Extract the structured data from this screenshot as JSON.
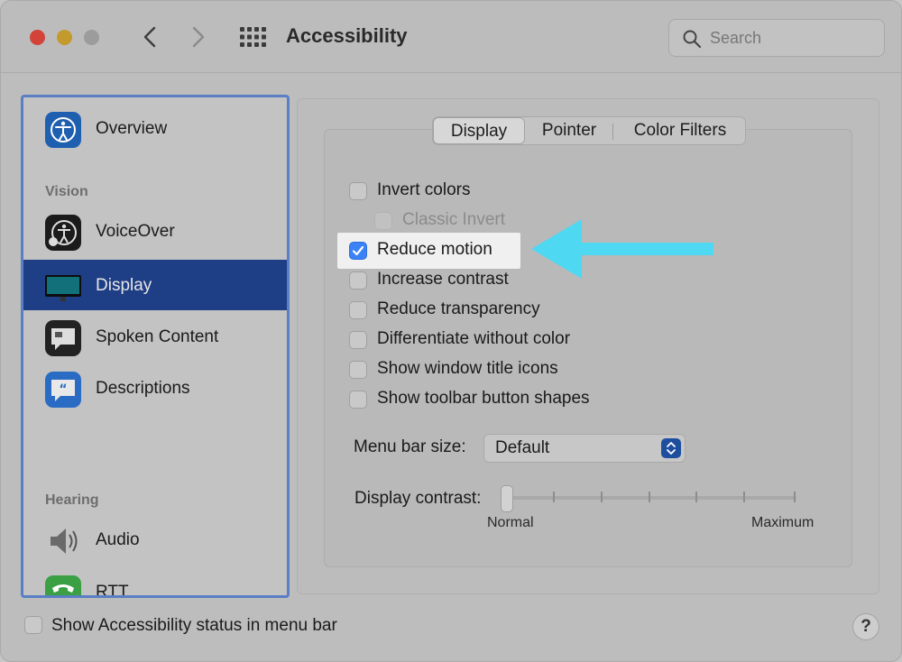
{
  "window": {
    "title": "Accessibility",
    "search_placeholder": "Search"
  },
  "sidebar": {
    "overview": "Overview",
    "section_vision": "Vision",
    "voiceover": "VoiceOver",
    "display": "Display",
    "spoken_content": "Spoken Content",
    "descriptions": "Descriptions",
    "section_hearing": "Hearing",
    "audio": "Audio",
    "rtt": "RTT"
  },
  "tabs": [
    "Display",
    "Pointer",
    "Color Filters"
  ],
  "options": [
    {
      "label": "Invert colors",
      "checked": false,
      "disabled": false
    },
    {
      "label": "Classic Invert",
      "checked": false,
      "disabled": true
    },
    {
      "label": "Reduce motion",
      "checked": true,
      "disabled": false
    },
    {
      "label": "Increase contrast",
      "checked": false,
      "disabled": false
    },
    {
      "label": "Reduce transparency",
      "checked": false,
      "disabled": false
    },
    {
      "label": "Differentiate without color",
      "checked": false,
      "disabled": false
    },
    {
      "label": "Show window title icons",
      "checked": false,
      "disabled": false
    },
    {
      "label": "Show toolbar button shapes",
      "checked": false,
      "disabled": false
    }
  ],
  "menu_bar_size": {
    "label": "Menu bar size:",
    "value": "Default"
  },
  "display_contrast": {
    "label": "Display contrast:",
    "min_label": "Normal",
    "max_label": "Maximum",
    "value": 0
  },
  "bottom": {
    "status_label": "Show Accessibility status in menu bar",
    "help": "?"
  },
  "colors": {
    "selection": "#1e3e85",
    "sidebar_border": "#5a7fc5",
    "checkbox_checked": "#3b82f7",
    "arrow": "#4fd8f2"
  }
}
